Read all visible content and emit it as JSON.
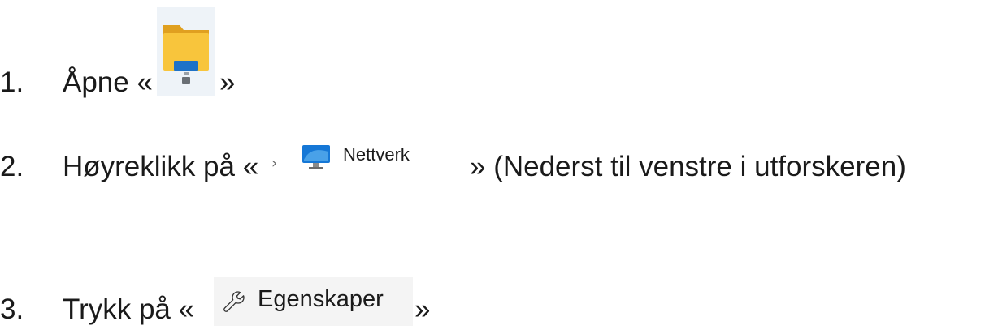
{
  "steps": [
    {
      "number": "1.",
      "text_before": "Åpne «",
      "text_after": "»",
      "icon": "file-explorer-icon"
    },
    {
      "number": "2.",
      "text_before": "Høyreklikk på «",
      "nav_item": {
        "chevron": "›",
        "label": "Nettverk",
        "icon": "network-icon"
      },
      "text_after": "» (Nederst til venstre i utforskeren)"
    },
    {
      "number": "3.",
      "text_before": "Trykk på «",
      "menu_item": {
        "label": "Egenskaper",
        "icon": "wrench-icon"
      },
      "text_after": "»"
    }
  ],
  "colors": {
    "text": "#1a1a1a",
    "folder_yellow": "#f8c53c",
    "folder_dark": "#e0a020",
    "drive_blue": "#1e72c8",
    "network_blue": "#1577d6",
    "menu_bg": "#f4f4f4"
  }
}
